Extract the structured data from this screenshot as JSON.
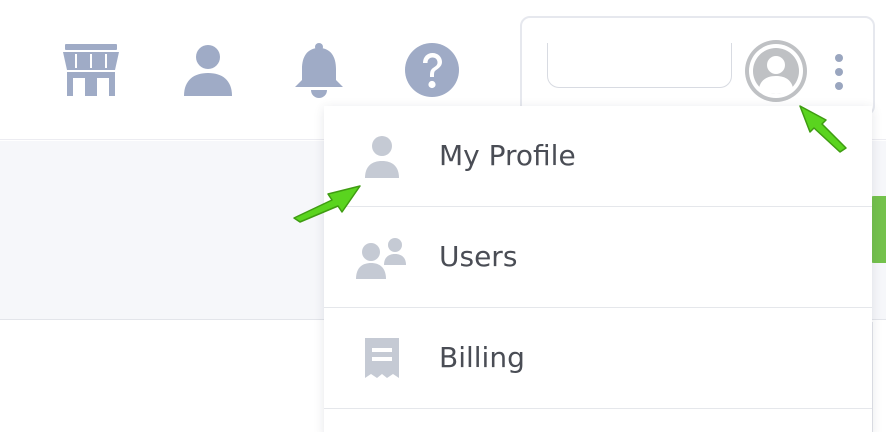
{
  "header": {
    "icons": [
      "store-icon",
      "user-icon",
      "bell-icon",
      "help-icon"
    ]
  },
  "account": {
    "name_value": ""
  },
  "menu": {
    "items": [
      {
        "label": "My Profile",
        "icon": "user-icon"
      },
      {
        "label": "Users",
        "icon": "users-icon"
      },
      {
        "label": "Billing",
        "icon": "receipt-icon"
      }
    ]
  },
  "colors": {
    "nav_icon": "#9fabc6",
    "menu_icon": "#c5cad4",
    "accent_green": "#74c24c",
    "annotation_arrow": "#5ad41f"
  }
}
